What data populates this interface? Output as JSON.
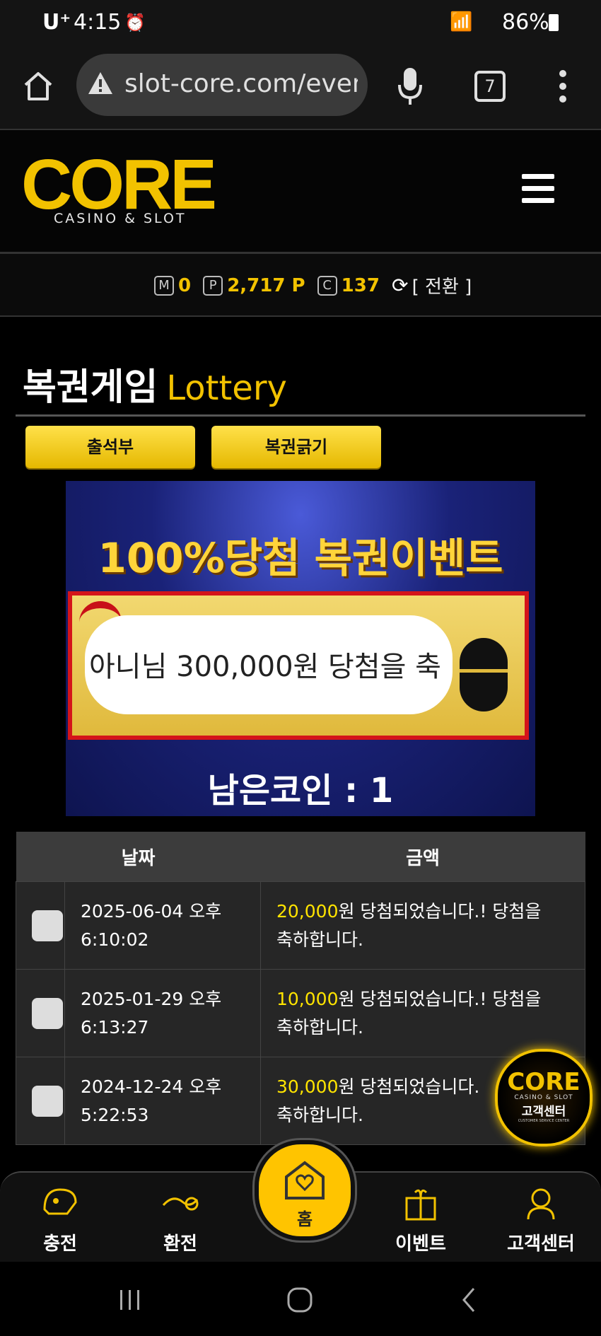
{
  "status_bar": {
    "carrier": "U⁺",
    "time": "4:15",
    "battery": "86%"
  },
  "browser": {
    "url": "slot-core.com/even",
    "tab_count": "7"
  },
  "header": {
    "logo": "CORE",
    "logo_sub": "CASINO & SLOT"
  },
  "points": {
    "m_label": "M",
    "m_value": "0",
    "p_label": "P",
    "p_value": "2,717 P",
    "c_label": "C",
    "c_value": "137",
    "convert_label": "[ 전환 ]"
  },
  "page": {
    "title_ko": "복권게임",
    "title_en": "Lottery"
  },
  "buttons": {
    "attendance": "출석부",
    "scratch": "복권긁기"
  },
  "banner": {
    "title": "100%당첨 복권이벤트",
    "scratch_text": "아니님  300,000원 당첨을 축",
    "coins": "남은코인 : 1"
  },
  "table": {
    "headers": [
      "날짜",
      "금액"
    ],
    "rows": [
      {
        "date_line1": "2025-06-04 오후",
        "date_line2": "6:10:02",
        "amount": "20,000",
        "msg_line1": "원 당첨되었습니다.! 당첨을",
        "msg_line2": "축하합니다."
      },
      {
        "date_line1": "2025-01-29 오후",
        "date_line2": "6:13:27",
        "amount": "10,000",
        "msg_line1": "원 당첨되었습니다.! 당첨을",
        "msg_line2": "축하합니다."
      },
      {
        "date_line1": "2024-12-24 오후",
        "date_line2": "5:22:53",
        "amount": "30,000",
        "msg_line1": "원 당첨되었습니다.",
        "msg_line2": "축하합니다."
      }
    ]
  },
  "cs_badge": {
    "logo": "CORE",
    "sub": "CASINO & SLOT",
    "label": "고객센터",
    "tiny": "CUSTOMER SERVICE CENTER"
  },
  "bottom_nav": {
    "charge": "충전",
    "exchange": "환전",
    "home": "홈",
    "event": "이벤트",
    "support": "고객센터"
  },
  "colors": {
    "accent": "#f2c200",
    "amount": "#ffe400",
    "background": "#000000"
  }
}
